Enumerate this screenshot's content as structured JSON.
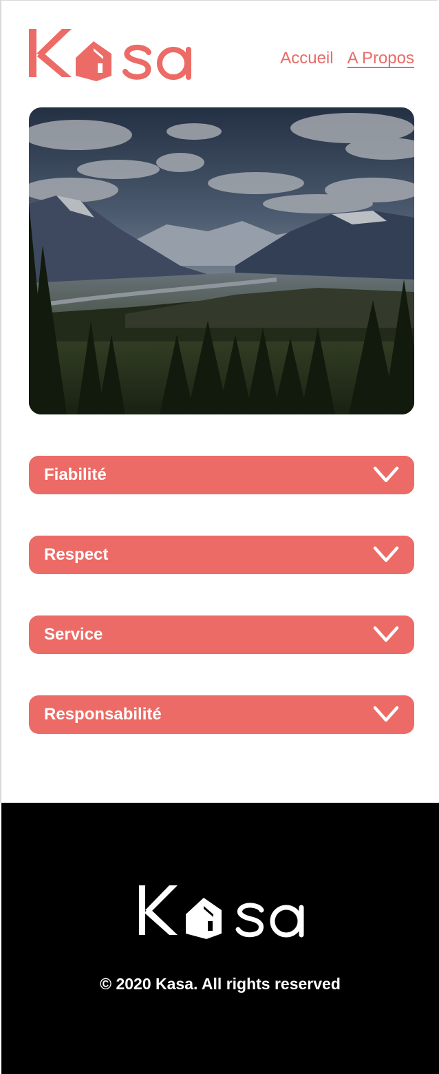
{
  "brand": {
    "name": "Kasa",
    "letters": {
      "k": "K",
      "s": "s",
      "a": "a"
    },
    "accent": "#ec6b66"
  },
  "nav": {
    "items": [
      {
        "label": "Accueil",
        "active": false
      },
      {
        "label": "A Propos",
        "active": true
      }
    ]
  },
  "banner": {
    "image": "mountain-valley-forest-photo"
  },
  "collapses": [
    {
      "title": "Fiabilité",
      "icon": "chevron-down-icon"
    },
    {
      "title": "Respect",
      "icon": "chevron-down-icon"
    },
    {
      "title": "Service",
      "icon": "chevron-down-icon"
    },
    {
      "title": "Responsabilité",
      "icon": "chevron-down-icon"
    }
  ],
  "footer": {
    "copyright": "© 2020 Kasa. All rights reserved",
    "background": "#000000"
  }
}
